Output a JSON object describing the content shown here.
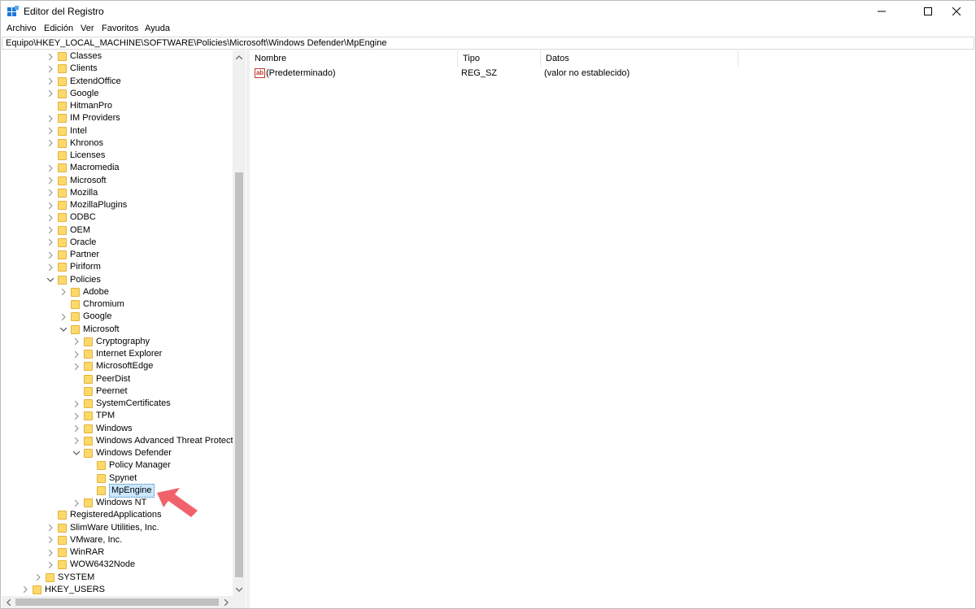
{
  "window": {
    "title": "Editor del Registro"
  },
  "menu": [
    "Archivo",
    "Edición",
    "Ver",
    "Favoritos",
    "Ayuda"
  ],
  "address": "Equipo\\HKEY_LOCAL_MACHINE\\SOFTWARE\\Policies\\Microsoft\\Windows Defender\\MpEngine",
  "tree": [
    {
      "label": "Classes",
      "level": 3,
      "expander": "collapsed"
    },
    {
      "label": "Clients",
      "level": 3,
      "expander": "collapsed"
    },
    {
      "label": "ExtendOffice",
      "level": 3,
      "expander": "collapsed"
    },
    {
      "label": "Google",
      "level": 3,
      "expander": "collapsed"
    },
    {
      "label": "HitmanPro",
      "level": 3,
      "expander": "none"
    },
    {
      "label": "IM Providers",
      "level": 3,
      "expander": "collapsed"
    },
    {
      "label": "Intel",
      "level": 3,
      "expander": "collapsed"
    },
    {
      "label": "Khronos",
      "level": 3,
      "expander": "collapsed"
    },
    {
      "label": "Licenses",
      "level": 3,
      "expander": "none"
    },
    {
      "label": "Macromedia",
      "level": 3,
      "expander": "collapsed"
    },
    {
      "label": "Microsoft",
      "level": 3,
      "expander": "collapsed"
    },
    {
      "label": "Mozilla",
      "level": 3,
      "expander": "collapsed"
    },
    {
      "label": "MozillaPlugins",
      "level": 3,
      "expander": "collapsed"
    },
    {
      "label": "ODBC",
      "level": 3,
      "expander": "collapsed"
    },
    {
      "label": "OEM",
      "level": 3,
      "expander": "collapsed"
    },
    {
      "label": "Oracle",
      "level": 3,
      "expander": "collapsed"
    },
    {
      "label": "Partner",
      "level": 3,
      "expander": "collapsed"
    },
    {
      "label": "Piriform",
      "level": 3,
      "expander": "collapsed"
    },
    {
      "label": "Policies",
      "level": 3,
      "expander": "expanded"
    },
    {
      "label": "Adobe",
      "level": 4,
      "expander": "collapsed"
    },
    {
      "label": "Chromium",
      "level": 4,
      "expander": "none"
    },
    {
      "label": "Google",
      "level": 4,
      "expander": "collapsed"
    },
    {
      "label": "Microsoft",
      "level": 4,
      "expander": "expanded"
    },
    {
      "label": "Cryptography",
      "level": 5,
      "expander": "collapsed"
    },
    {
      "label": "Internet Explorer",
      "level": 5,
      "expander": "collapsed"
    },
    {
      "label": "MicrosoftEdge",
      "level": 5,
      "expander": "collapsed"
    },
    {
      "label": "PeerDist",
      "level": 5,
      "expander": "none"
    },
    {
      "label": "Peernet",
      "level": 5,
      "expander": "none"
    },
    {
      "label": "SystemCertificates",
      "level": 5,
      "expander": "collapsed"
    },
    {
      "label": "TPM",
      "level": 5,
      "expander": "collapsed"
    },
    {
      "label": "Windows",
      "level": 5,
      "expander": "collapsed"
    },
    {
      "label": "Windows Advanced Threat Protection",
      "level": 5,
      "expander": "collapsed"
    },
    {
      "label": "Windows Defender",
      "level": 5,
      "expander": "expanded"
    },
    {
      "label": "Policy Manager",
      "level": 6,
      "expander": "none"
    },
    {
      "label": "Spynet",
      "level": 6,
      "expander": "none"
    },
    {
      "label": "MpEngine",
      "level": 6,
      "expander": "none",
      "selected": true
    },
    {
      "label": "Windows NT",
      "level": 5,
      "expander": "collapsed"
    },
    {
      "label": "RegisteredApplications",
      "level": 3,
      "expander": "none"
    },
    {
      "label": "SlimWare Utilities, Inc.",
      "level": 3,
      "expander": "collapsed"
    },
    {
      "label": "VMware, Inc.",
      "level": 3,
      "expander": "collapsed"
    },
    {
      "label": "WinRAR",
      "level": 3,
      "expander": "collapsed"
    },
    {
      "label": "WOW6432Node",
      "level": 3,
      "expander": "collapsed"
    },
    {
      "label": "SYSTEM",
      "level": 2,
      "expander": "collapsed"
    },
    {
      "label": "HKEY_USERS",
      "level": 1,
      "expander": "collapsed"
    }
  ],
  "values_pane": {
    "columns": [
      "Nombre",
      "Tipo",
      "Datos"
    ],
    "rows": [
      {
        "icon": "string-value-icon",
        "icon_text": "ab",
        "name": "(Predeterminado)",
        "type": "REG_SZ",
        "data": "(valor no establecido)"
      }
    ]
  },
  "colors": {
    "folder": "#fcd96a",
    "selection": "#cce8ff",
    "annotation_arrow": "#f0626a"
  }
}
